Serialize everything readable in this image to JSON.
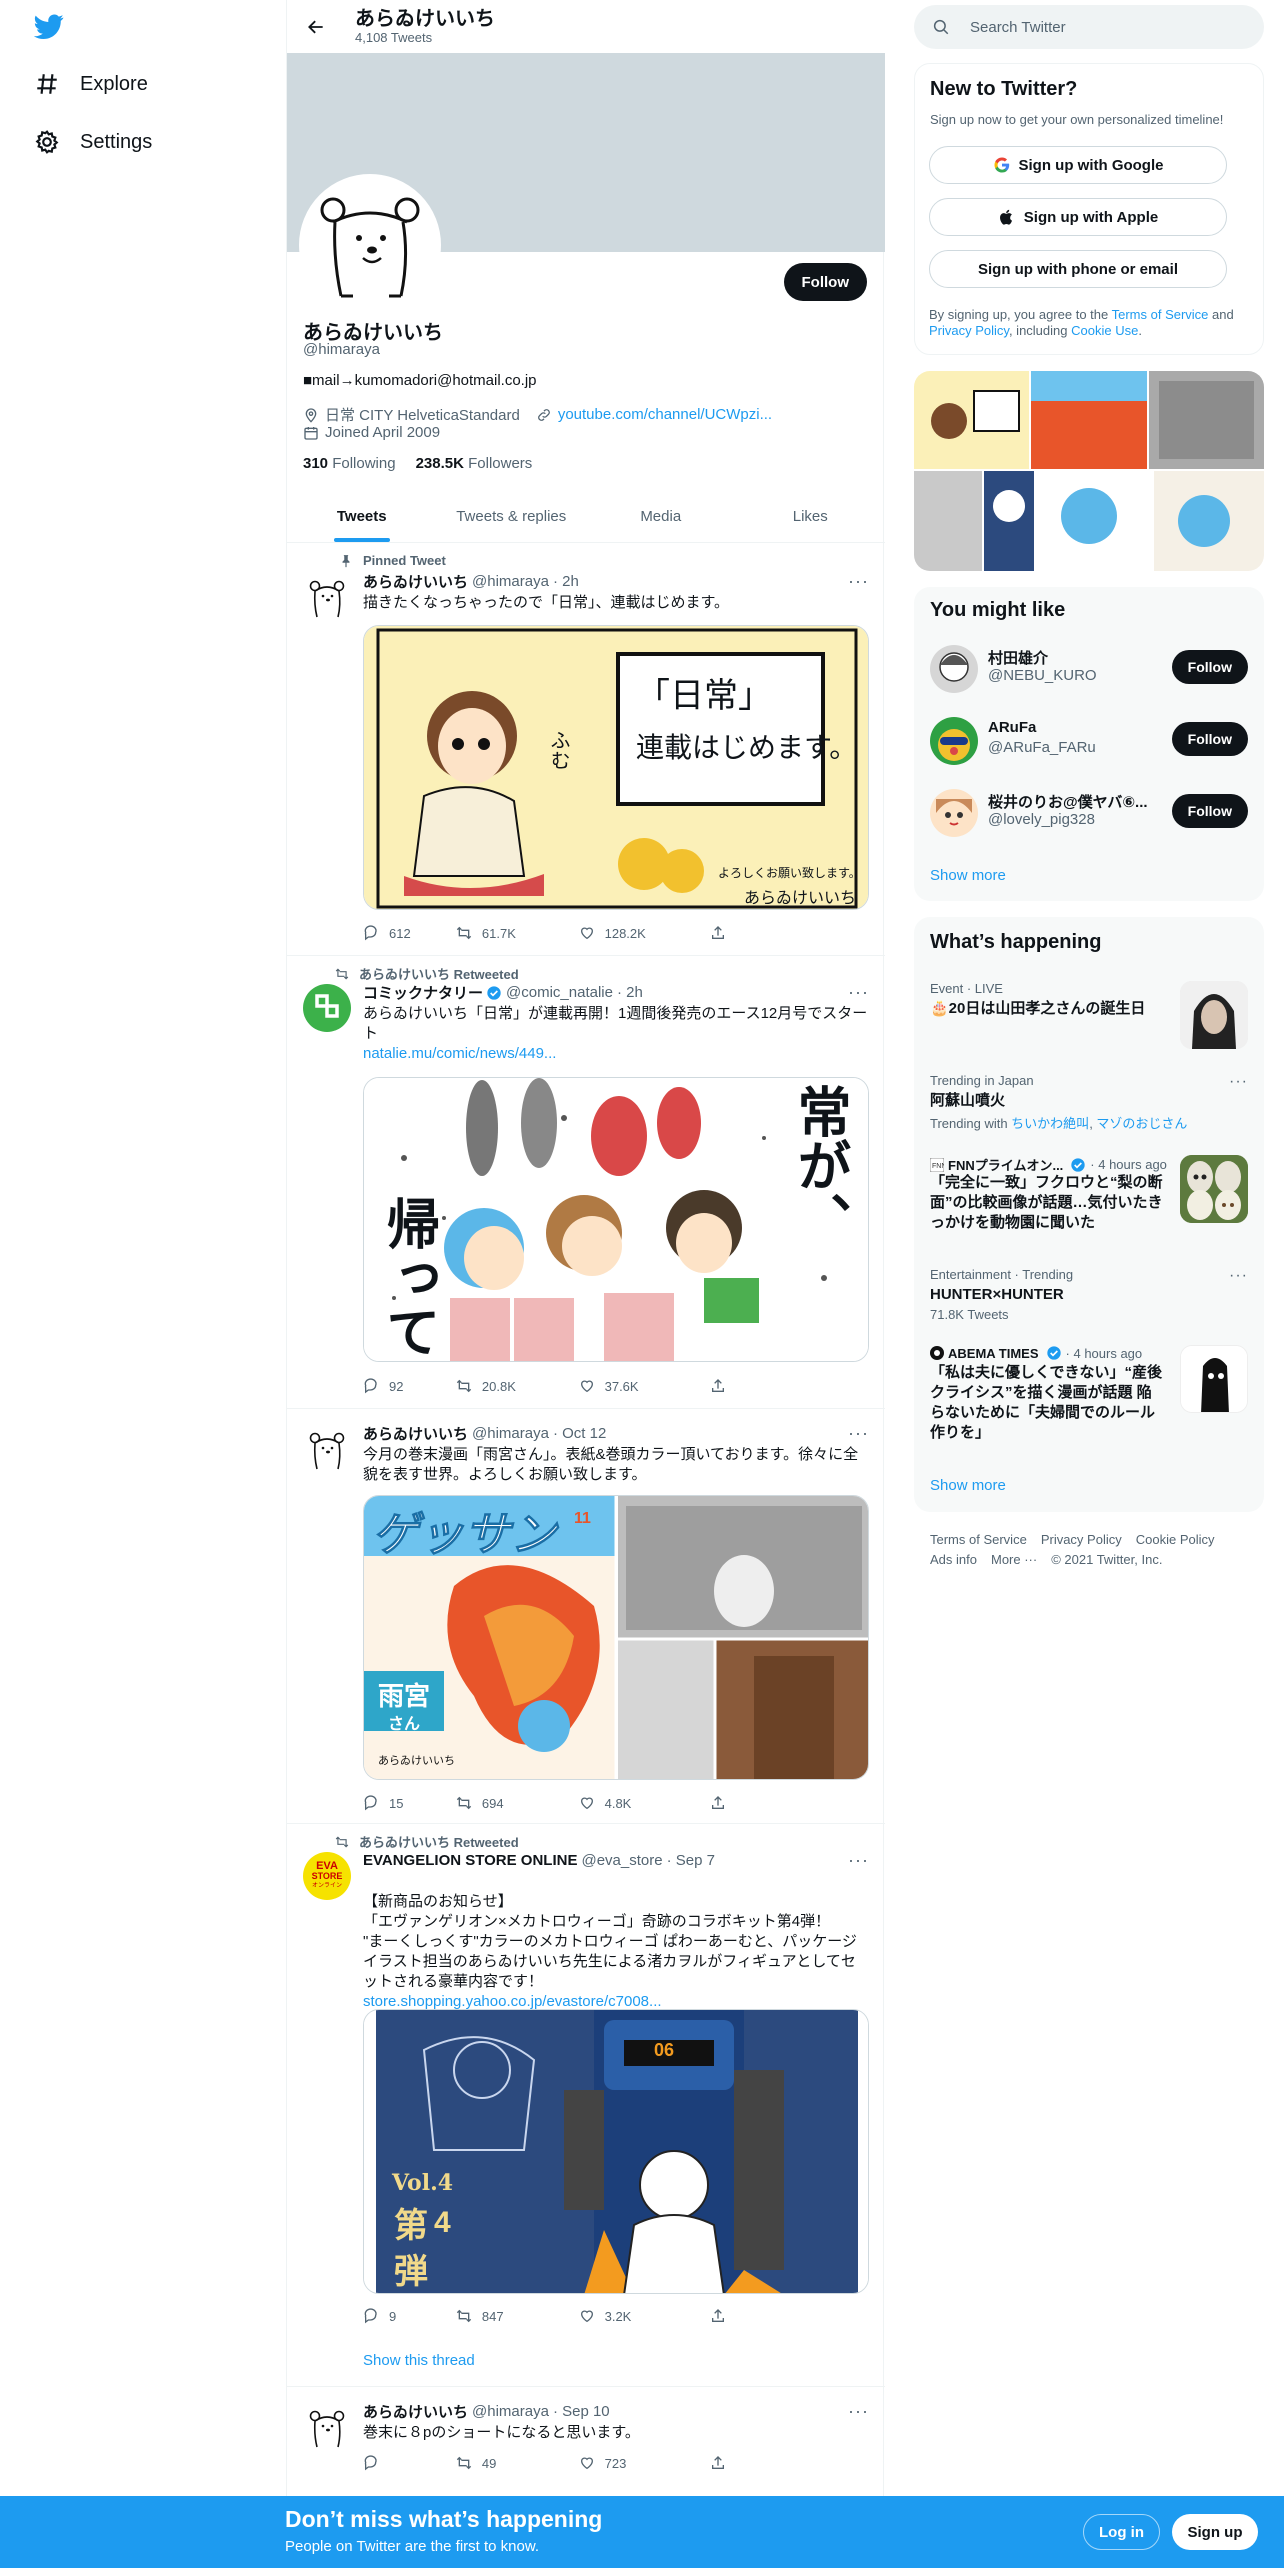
{
  "nav": {
    "explore": "Explore",
    "settings": "Settings"
  },
  "profile": {
    "name": "あらゐけいいち",
    "tweet_count": "4,108 Tweets",
    "handle": "@himaraya",
    "bio": "■mail→kumomadori@hotmail.co.jp",
    "location": "日常 CITY HelveticaStandard",
    "website": "youtube.com/channel/UCWpzi...",
    "joined": "Joined April 2009",
    "following_count": "310",
    "following_label": "Following",
    "followers_count": "238.5K",
    "followers_label": "Followers",
    "follow_label": "Follow"
  },
  "tabs": [
    "Tweets",
    "Tweets & replies",
    "Media",
    "Likes"
  ],
  "tweets": [
    {
      "social": "Pinned Tweet",
      "name": "あらゐけいいち",
      "handle": "@himaraya",
      "time": "· 2h",
      "text": "描きたくなっちゃったので「日常」、連載はじめます。",
      "replies": "612",
      "retweets": "61.7K",
      "likes": "128.2K",
      "media_text_1": "「日常」",
      "media_text_2": "連載はじめます。",
      "media_text_3": "ふむ",
      "media_text_4": "よろしくお願い致します。",
      "media_text_5": "あらゐけいいち"
    },
    {
      "social": "あらゐけいいち Retweeted",
      "name": "コミックナタリー",
      "handle": "@comic_natalie",
      "time": "· 2h",
      "text": "あらゐけいいち「日常」が連載再開！1週間後発売のエース12月号でスタート",
      "link": "natalie.mu/comic/news/449...",
      "replies": "92",
      "retweets": "20.8K",
      "likes": "37.6K",
      "media_text_1": "常が、",
      "media_text_2": "帰って"
    },
    {
      "name": "あらゐけいいち",
      "handle": "@himaraya",
      "time": "· Oct 12",
      "text": "今月の巻末漫画「雨宮さん」。表紙&巻頭カラー頂いております。徐々に全貌を表す世界。よろしくお願い致します。",
      "replies": "15",
      "retweets": "694",
      "likes": "4.8K",
      "media_text_1": "ゲッサン",
      "media_text_2": "11",
      "media_text_3": "雨宮",
      "media_text_4": "さん",
      "media_text_5": "あらゐけいいち"
    },
    {
      "social": "あらゐけいいち Retweeted",
      "name": "EVANGELION STORE ONLINE",
      "handle": "@eva_store",
      "time": "· Sep 7",
      "text": "【新商品のお知らせ】\n「エヴァンゲリオン×メカトロウィーゴ」奇跡のコラボキット第4弾！\n\"まーくしっくす\"カラーのメカトロウィーゴ ぱわーあーむと、パッケージイラスト担当のあらゐけいいち先生による渚カヲルがフィギュアとしてセットされる豪華内容です！",
      "link": "store.shopping.yahoo.co.jp/evastore/c7008...",
      "replies": "9",
      "retweets": "847",
      "likes": "3.2K",
      "show_thread": "Show this thread",
      "avatar_text_1": "EVA",
      "avatar_text_2": "STORE",
      "avatar_text_3": "オンライン",
      "media_text_1": "Vol.4",
      "media_text_2": "第",
      "media_text_3": "4",
      "media_text_4": "弾",
      "media_text_5": "06"
    },
    {
      "name": "あらゐけいいち",
      "handle": "@himaraya",
      "time": "· Sep 10",
      "text": "巻末に８pのショートになると思います。",
      "replies": "",
      "retweets": "49",
      "likes": "723"
    }
  ],
  "search": {
    "placeholder": "Search Twitter"
  },
  "new_to_twitter": {
    "title": "New to Twitter?",
    "subtitle": "Sign up now to get your own personalized timeline!",
    "google": "Sign up with Google",
    "apple": "Sign up with Apple",
    "phone": "Sign up with phone or email",
    "terms_1": "By signing up, you agree to the ",
    "terms_link": "Terms of Service",
    "terms_2": " and ",
    "privacy_link": "Privacy Policy",
    "terms_3": ", including ",
    "cookie_link": "Cookie Use",
    "terms_4": "."
  },
  "you_might_like": {
    "title": "You might like",
    "users": [
      {
        "name": "村田雄介",
        "handle": "@NEBU_KURO",
        "follow": "Follow"
      },
      {
        "name": "ARuFa",
        "handle": "@ARuFa_FARu",
        "follow": "Follow"
      },
      {
        "name": "桜井のりお@僕ヤバ⑥...",
        "handle": "@lovely_pig328",
        "follow": "Follow"
      }
    ],
    "show_more": "Show more"
  },
  "whats_happening": {
    "title": "What’s happening",
    "trends": [
      {
        "meta": "Event · LIVE",
        "title": "🎂20日は山田孝之さんの誕生日"
      },
      {
        "meta": "Trending in Japan",
        "title": "阿蘇山噴火",
        "sub_prefix": "Trending with ",
        "sub_link_1": "ちいかわ絶叫",
        "sub_sep": ", ",
        "sub_link_2": "マゾのおじさん"
      },
      {
        "meta_source": "FNNプライムオン...",
        "meta_time": "· 4 hours ago",
        "title": "「完全に一致」フクロウと“梨の断面”の比較画像が話題…気付いたきっかけを動物園に聞いた"
      },
      {
        "meta": "Entertainment · Trending",
        "title": "HUNTER×HUNTER",
        "sub": "71.8K Tweets"
      },
      {
        "meta_source": "ABEMA TIMES",
        "meta_time": "· 4 hours ago",
        "title": "「私は夫に優しくできない」“産後クライシス”を描く漫画が話題 陥らないために「夫婦間でのルール作りを」"
      }
    ],
    "show_more": "Show more"
  },
  "footer": {
    "links": [
      "Terms of Service",
      "Privacy Policy",
      "Cookie Policy",
      "Ads info",
      "More ···"
    ],
    "copyright": "© 2021 Twitter, Inc."
  },
  "bottom_bar": {
    "title": "Don’t miss what’s happening",
    "subtitle": "People on Twitter are the first to know.",
    "login": "Log in",
    "signup": "Sign up"
  },
  "colors": {
    "accent": "#1d9bf0",
    "text": "#0f1419",
    "secondary": "#536471",
    "banner": "#cfd9de"
  }
}
